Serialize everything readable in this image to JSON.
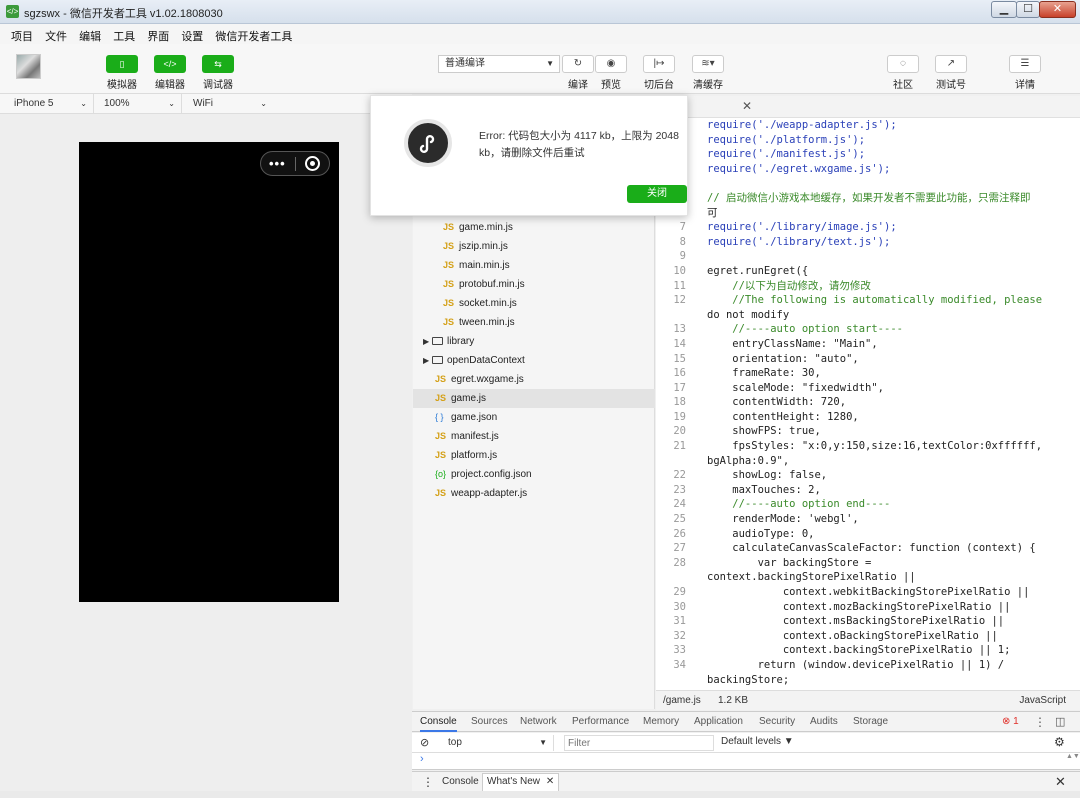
{
  "window": {
    "title": "sgzswx - 微信开发者工具 v1.02.1808030",
    "logo": "</>",
    "min": "▁",
    "max": "☐",
    "close": "✕"
  },
  "menu": [
    "项目",
    "文件",
    "编辑",
    "工具",
    "界面",
    "设置",
    "微信开发者工具"
  ],
  "toolbar": {
    "simulator": "模拟器",
    "editor": "编辑器",
    "debugger": "调试器",
    "compile_mode": "普通编译",
    "compile": "编译",
    "preview": "预览",
    "backstage": "切后台",
    "cache": "清缓存",
    "community": "社区",
    "test": "测试号",
    "details": "详情"
  },
  "device": {
    "model": "iPhone 5",
    "zoom": "100%",
    "network": "WiFi"
  },
  "files": [
    {
      "name": "game.min.js",
      "type": "js",
      "indent": 2
    },
    {
      "name": "jszip.min.js",
      "type": "js",
      "indent": 2
    },
    {
      "name": "main.min.js",
      "type": "js",
      "indent": 2
    },
    {
      "name": "protobuf.min.js",
      "type": "js",
      "indent": 2
    },
    {
      "name": "socket.min.js",
      "type": "js",
      "indent": 2
    },
    {
      "name": "tween.min.js",
      "type": "js",
      "indent": 2
    },
    {
      "name": "library",
      "type": "folder",
      "indent": 0
    },
    {
      "name": "openDataContext",
      "type": "folder",
      "indent": 0
    },
    {
      "name": "egret.wxgame.js",
      "type": "js",
      "indent": 1
    },
    {
      "name": "game.js",
      "type": "js",
      "indent": 1,
      "selected": true
    },
    {
      "name": "game.json",
      "type": "json",
      "indent": 1
    },
    {
      "name": "manifest.js",
      "type": "js",
      "indent": 1
    },
    {
      "name": "platform.js",
      "type": "js",
      "indent": 1
    },
    {
      "name": "project.config.json",
      "type": "config",
      "indent": 1
    },
    {
      "name": "weapp-adapter.js",
      "type": "js",
      "indent": 1
    }
  ],
  "code_lines": [
    {
      "n": "",
      "t": "require('./weapp-adapter.js');"
    },
    {
      "n": "",
      "t": "require('./platform.js');"
    },
    {
      "n": "",
      "t": "require('./manifest.js');"
    },
    {
      "n": "",
      "t": "require('./egret.wxgame.js');"
    },
    {
      "n": "",
      "t": ""
    },
    {
      "n": "",
      "t": "// 启动微信小游戏本地缓存，如果开发者不需要此功能，只需注释即"
    },
    {
      "n": "",
      "t": "可"
    },
    {
      "n": "7",
      "t": "require('./library/image.js');"
    },
    {
      "n": "8",
      "t": "require('./library/text.js');"
    },
    {
      "n": "9",
      "t": ""
    },
    {
      "n": "10",
      "t": "egret.runEgret({"
    },
    {
      "n": "11",
      "t": "    //以下为自动修改，请勿修改"
    },
    {
      "n": "12",
      "t": "    //The following is automatically modified, please"
    },
    {
      "n": "",
      "t": "do not modify"
    },
    {
      "n": "13",
      "t": "    //----auto option start----"
    },
    {
      "n": "14",
      "t": "    entryClassName: \"Main\","
    },
    {
      "n": "15",
      "t": "    orientation: \"auto\","
    },
    {
      "n": "16",
      "t": "    frameRate: 30,"
    },
    {
      "n": "17",
      "t": "    scaleMode: \"fixedwidth\","
    },
    {
      "n": "18",
      "t": "    contentWidth: 720,"
    },
    {
      "n": "19",
      "t": "    contentHeight: 1280,"
    },
    {
      "n": "20",
      "t": "    showFPS: true,"
    },
    {
      "n": "21",
      "t": "    fpsStyles: \"x:0,y:150,size:16,textColor:0xffffff,"
    },
    {
      "n": "",
      "t": "bgAlpha:0.9\","
    },
    {
      "n": "22",
      "t": "    showLog: false,"
    },
    {
      "n": "23",
      "t": "    maxTouches: 2,"
    },
    {
      "n": "24",
      "t": "    //----auto option end----"
    },
    {
      "n": "25",
      "t": "    renderMode: 'webgl',"
    },
    {
      "n": "26",
      "t": "    audioType: 0,"
    },
    {
      "n": "27",
      "t": "    calculateCanvasScaleFactor: function (context) {"
    },
    {
      "n": "28",
      "t": "        var backingStore ="
    },
    {
      "n": "",
      "t": "context.backingStorePixelRatio ||"
    },
    {
      "n": "29",
      "t": "            context.webkitBackingStorePixelRatio ||"
    },
    {
      "n": "30",
      "t": "            context.mozBackingStorePixelRatio ||"
    },
    {
      "n": "31",
      "t": "            context.msBackingStorePixelRatio ||"
    },
    {
      "n": "32",
      "t": "            context.oBackingStorePixelRatio ||"
    },
    {
      "n": "33",
      "t": "            context.backingStorePixelRatio || 1;"
    },
    {
      "n": "34",
      "t": "        return (window.devicePixelRatio || 1) /"
    },
    {
      "n": "",
      "t": "backingStore;"
    }
  ],
  "status": {
    "path": "/game.js",
    "size": "1.2 KB",
    "lang": "JavaScript"
  },
  "devtools": {
    "tabs": [
      "Console",
      "Sources",
      "Network",
      "Performance",
      "Memory",
      "Application",
      "Security",
      "Audits",
      "Storage"
    ],
    "errors": "1",
    "context": "top",
    "filter_placeholder": "Filter",
    "levels": "Default levels ▼",
    "prompt": "›",
    "drawer_tabs": [
      "Console",
      "What's New"
    ]
  },
  "dialog": {
    "message": "Error: 代码包大小为 4117 kb，上限为 2048 kb，请删除文件后重试",
    "close": "关闭"
  },
  "colors": {
    "accent": "#1aad19",
    "error": "#e0302a"
  }
}
